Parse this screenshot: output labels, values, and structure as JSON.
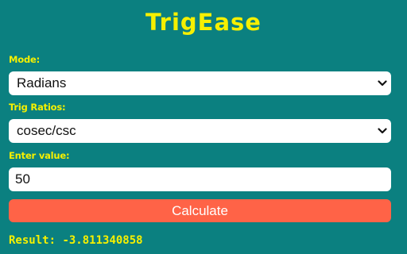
{
  "app": {
    "title": "TrigEase"
  },
  "mode": {
    "label": "Mode:",
    "selected": "Radians"
  },
  "ratio": {
    "label": "Trig Ratios:",
    "selected": "cosec/csc"
  },
  "value": {
    "label": "Enter value:",
    "current": "50"
  },
  "calculate_button": {
    "label": "Calculate"
  },
  "result": {
    "label": "Result:",
    "value": "-3.811340858"
  },
  "colors": {
    "background": "#0b8080",
    "accent_text": "#f6f000",
    "button": "#ff6347"
  },
  "icons": {
    "select_arrow": "chevron-down-icon"
  }
}
